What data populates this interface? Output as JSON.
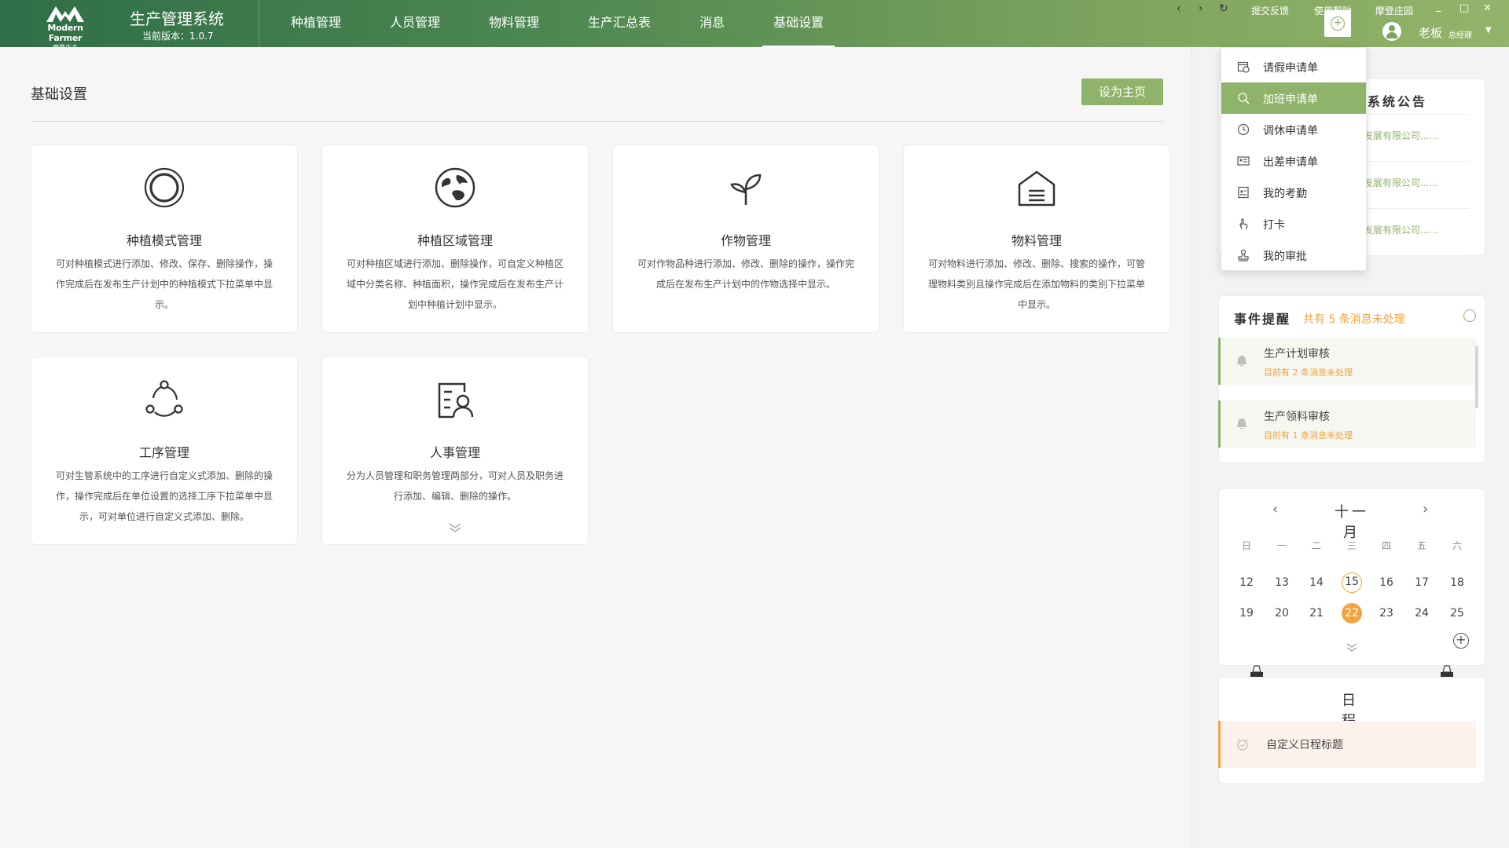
{
  "header": {
    "logo_en": "Modern Farmer",
    "logo_cn": "摩登庄主",
    "system_title": "生产管理系统",
    "version": "当前版本：1.0.7",
    "nav": [
      "种植管理",
      "人员管理",
      "物料管理",
      "生产汇总表",
      "消息",
      "基础设置"
    ],
    "active_nav": "基础设置",
    "links": {
      "feedback": "提交反馈",
      "help": "使用帮助",
      "farm": "摩登庄园"
    },
    "user": {
      "name": "老板",
      "role": "总经理"
    },
    "window_controls": [
      "_",
      "□",
      "✕"
    ],
    "nav_controls": [
      "‹",
      "›",
      "↻"
    ]
  },
  "main": {
    "title": "基础设置",
    "set_home_button": "设为主页",
    "cards": [
      {
        "title": "种植模式管理",
        "desc": "可对种植模式进行添加、修改、保存、删除操作，操作完成后在发布生产计划中的种植模式下拉菜单中显示。",
        "icon": "target-circle-icon"
      },
      {
        "title": "种植区域管理",
        "desc": "可对种植区域进行添加、删除操作，可自定义种植区域中分类名称、种植面积，操作完成后在发布生产计划中种植计划中显示。",
        "icon": "globe-icon"
      },
      {
        "title": "作物管理",
        "desc": "可对作物品种进行添加、修改、删除的操作，操作完成后在发布生产计划中的作物选择中显示。",
        "icon": "sprout-icon"
      },
      {
        "title": "物料管理",
        "desc": "可对物料进行添加、修改、删除、搜索的操作，可管理物料类别且操作完成后在添加物料的类别下拉菜单中显示。",
        "icon": "warehouse-icon"
      },
      {
        "title": "工序管理",
        "desc": "可对生管系统中的工序进行自定义式添加、删除的操作，操作完成后在单位设置的选择工序下拉菜单中显示，可对单位进行自定义式添加、删除。",
        "icon": "process-cycle-icon"
      },
      {
        "title": "人事管理",
        "desc": "分为人员管理和职务管理两部分，可对人员及职务进行添加、编辑、删除的操作。",
        "icon": "personnel-icon"
      }
    ]
  },
  "dropdown": {
    "items": [
      "请假申请单",
      "加班申请单",
      "调休申请单",
      "出差申请单",
      "我的考勤",
      "打卡",
      "我的审批"
    ],
    "active_index": 1
  },
  "notice": {
    "title": "系统公告",
    "items": [
      "发展有限公司......",
      "发展有限公司......",
      "发展有限公司......"
    ]
  },
  "events": {
    "title": "事件提醒",
    "summary": "共有 5 条消息未处理",
    "items": [
      {
        "title": "生产计划审核",
        "status": "目前有   2   条消息未处理"
      },
      {
        "title": "生产领料审核",
        "status": "目前有   1   条消息未处理"
      }
    ]
  },
  "calendar": {
    "month": "十一月",
    "prev": "‹",
    "next": "›",
    "weekdays": [
      "日",
      "一",
      "二",
      "三",
      "四",
      "五",
      "六"
    ],
    "weeks": [
      [
        "12",
        "13",
        "14",
        "15",
        "16",
        "17",
        "18"
      ],
      [
        "19",
        "20",
        "21",
        "22",
        "23",
        "24",
        "25"
      ]
    ],
    "today": "15",
    "selected": "22"
  },
  "schedule": {
    "title": "日程",
    "item": "自定义日程标题"
  },
  "colors": {
    "accent_green": "#8fb36b",
    "accent_orange": "#f2a342",
    "header_dark": "#2f6e47"
  }
}
